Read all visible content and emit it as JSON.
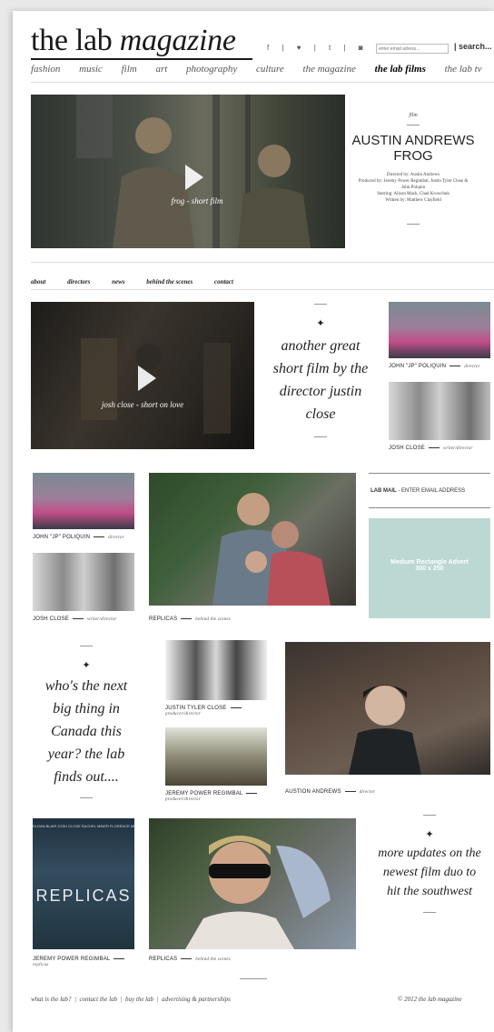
{
  "header": {
    "logo_plain": "the lab",
    "logo_italic": "magazine",
    "social": "f | ♥ | t | ◙ |",
    "email_placeholder": "enter email adress...",
    "search_label": "| search..."
  },
  "nav": [
    "fashion",
    "music",
    "film",
    "art",
    "photography",
    "culture",
    "the magazine",
    "the lab films",
    "the lab tv"
  ],
  "nav_active": "the lab films",
  "feature": {
    "video_label": "frog - short film",
    "category": "film",
    "title": "AUSTIN ANDREWS FROG",
    "credits": [
      "Directed by: Austin Andrews",
      "Produced by: Jeremy Power Regimbal, Justin Tyler Close &",
      "John Polquin",
      "Starring: Alison Mack, Chad Krowchuk",
      "Written by: Matthew Clayfield"
    ]
  },
  "subnav": [
    "about",
    "directors",
    "news",
    "behind the scenes",
    "contact"
  ],
  "row1": {
    "video_label": "josh close - short on love",
    "quote": "another great short film by the director justin close",
    "captions": [
      {
        "name": "JOHN \"JP\" POLIQUIN",
        "role": "director"
      },
      {
        "name": "JOSH CLOSE",
        "role": "writer/director"
      }
    ]
  },
  "row2": {
    "captions": [
      {
        "name": "JOHN \"JP\" POLIQUIN",
        "role": "director"
      },
      {
        "name": "JOSH CLOSE",
        "role": "writer/director"
      }
    ],
    "big_caption": {
      "name": "REPLICAS",
      "role": "behind the scenes"
    },
    "lab_mail_label": "LAB MAIL",
    "lab_mail_placeholder": "ENTER EMAIL ADDRESS",
    "ad_line1": "Medium Rectangle Advert",
    "ad_line2": "300 x 250"
  },
  "row3": {
    "quote": "who's the next big thing in Canada this year? the lab finds out....",
    "captions": [
      {
        "name": "JUSTIN TYLER CLOSE",
        "role": "producer/director"
      },
      {
        "name": "JEREMY POWER REGIMBAL",
        "role": "producer/director"
      },
      {
        "name": "AUSTION ANDREWS",
        "role": "director"
      }
    ]
  },
  "row4": {
    "poster_text": "REPLICAS",
    "poster_names": "SLOAN BLAIR   JOSH CLOSE   RACHEL MINER   FLORENCE MILLY",
    "captions": [
      {
        "name": "JEREMY POWER REGIMBAL",
        "role": "replicas"
      },
      {
        "name": "REPLICAS",
        "role": "behind the scenes"
      }
    ],
    "quote": "more updates on the newest film duo to hit the southwest"
  },
  "footer": {
    "links": [
      "what is the lab?",
      "contact the lab",
      "buy the lab",
      "advertising & partnerships"
    ],
    "copyright": "© 2012 the lab magazine"
  }
}
